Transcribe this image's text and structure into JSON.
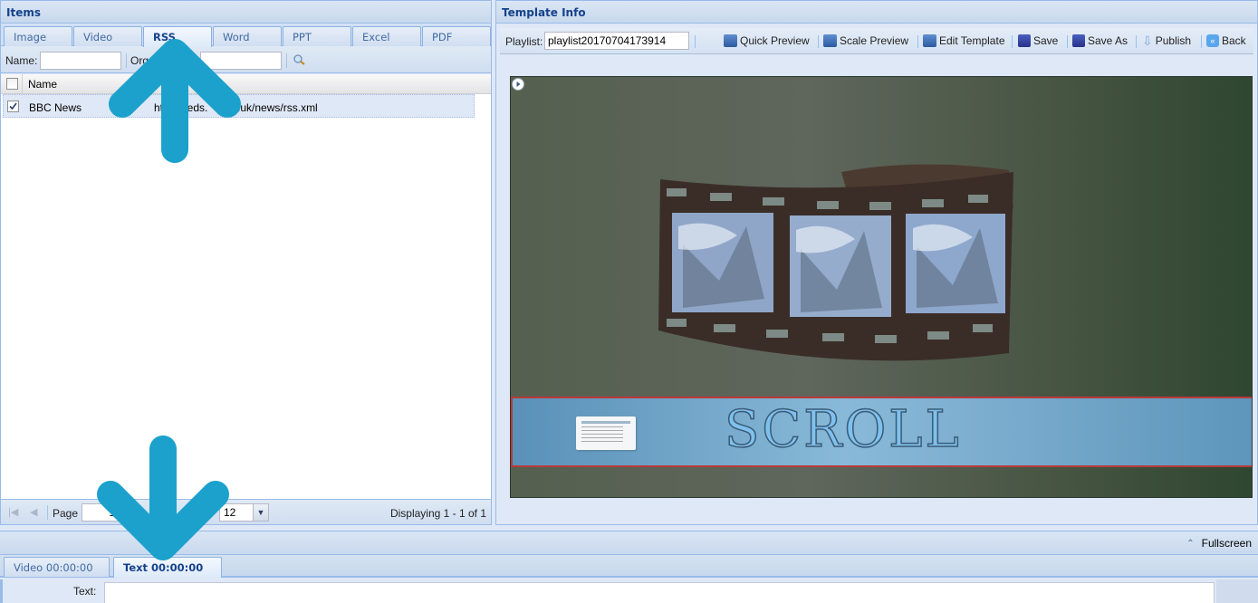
{
  "items_panel": {
    "title": "Items",
    "tabs": [
      {
        "label": "Image",
        "active": false
      },
      {
        "label": "Video",
        "active": false
      },
      {
        "label": "RSS",
        "active": true
      },
      {
        "label": "Word",
        "active": false
      },
      {
        "label": "PPT",
        "active": false
      },
      {
        "label": "Excel",
        "active": false
      },
      {
        "label": "PDF",
        "active": false
      }
    ],
    "filter": {
      "name_label": "Name:",
      "name_value": "",
      "org_label": "Org",
      "org_value": ""
    },
    "grid": {
      "columns": [
        "Name"
      ],
      "rows": [
        {
          "checked": true,
          "name": "BBC News",
          "url": "http://feeds.bbci.co.uk/news/rss.xml",
          "url_visible": "ht      eeds.      co.uk/news/rss.xml"
        }
      ]
    },
    "pager": {
      "page_label": "Page",
      "page_value": "1",
      "page_size": "12",
      "display_text": "Displaying 1 - 1 of 1"
    }
  },
  "template_panel": {
    "title": "Template Info",
    "playlist_label": "Playlist:",
    "playlist_value": "playlist20170704173914",
    "toolbar": {
      "quick_preview": "Quick Preview",
      "scale_preview": "Scale Preview",
      "edit_template": "Edit Template",
      "save": "Save",
      "save_as": "Save As",
      "publish": "Publish",
      "back": "Back"
    },
    "preview": {
      "scroll_text": "SCROLL"
    }
  },
  "bottom": {
    "fullscreen_label": "Fullscreen",
    "tabs": [
      {
        "label": "Video 00:00:00",
        "active": false
      },
      {
        "label": "Text 00:00:00",
        "active": true
      }
    ],
    "text_label": "Text:",
    "text_value": ""
  },
  "colors": {
    "header_text": "#15428b",
    "panel_bg": "#dfe8f6",
    "border": "#99bbe8",
    "arrow": "#1ba1cc",
    "scroll_border": "#b83a3a"
  }
}
